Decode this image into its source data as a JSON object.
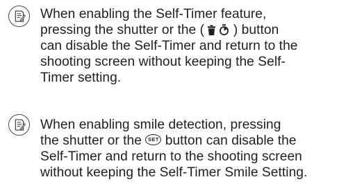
{
  "notes": [
    {
      "icon": "note-pad-icon",
      "lines": [
        {
          "text": "When enabling the Self-Timer feature,"
        },
        {
          "before": "pressing the shutter or the ( ",
          "icons": [
            "trash-icon",
            "self-timer-icon"
          ],
          "after": " ) button"
        },
        {
          "text": "can disable the Self-Timer and return to the"
        },
        {
          "text": "shooting screen without keeping the Self-"
        },
        {
          "text": "Timer setting."
        }
      ]
    },
    {
      "icon": "note-pad-icon",
      "lines": [
        {
          "text": "When enabling smile detection, pressing"
        },
        {
          "before": "the shutter or the ",
          "icons": [
            "set-button-icon"
          ],
          "after": " button can disable the"
        },
        {
          "text": "Self-Timer and return to the shooting screen"
        },
        {
          "text": "without keeping the Self-Timer Smile Setting."
        }
      ]
    }
  ],
  "set_button_label": "SET"
}
